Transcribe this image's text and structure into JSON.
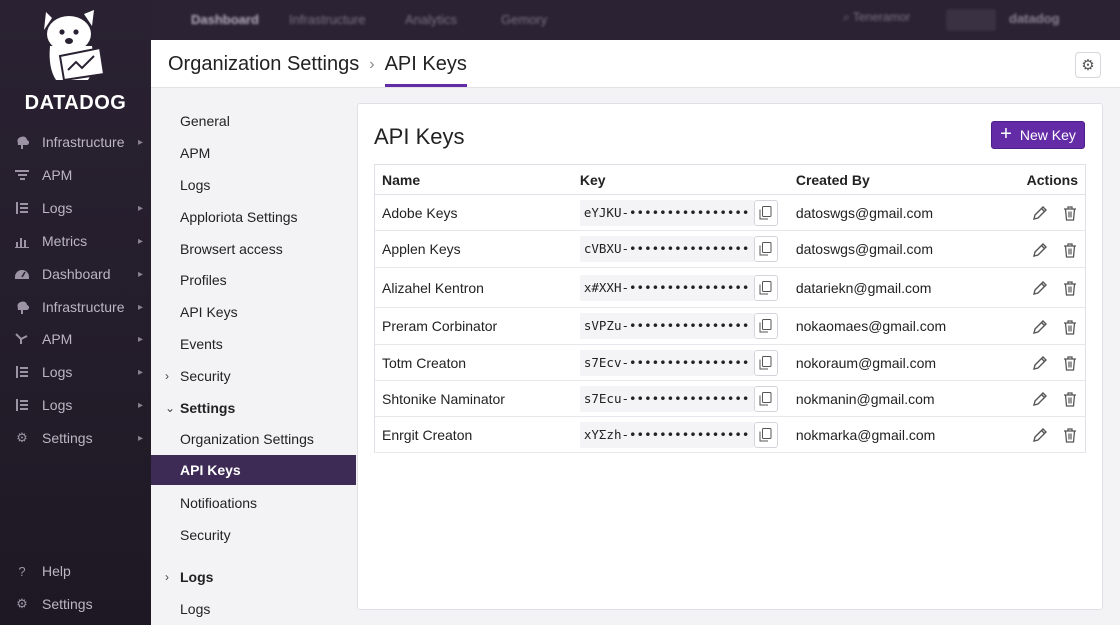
{
  "brand": {
    "name": "DATADOG"
  },
  "sidebar": {
    "items": [
      {
        "label": "Infrastructure",
        "icon": "infrastructure-icon",
        "chevron": true
      },
      {
        "label": "APM",
        "icon": "apm-icon",
        "chevron": false
      },
      {
        "label": "Logs",
        "icon": "logs-icon",
        "chevron": true
      },
      {
        "label": "Metrics",
        "icon": "metrics-icon",
        "chevron": true
      },
      {
        "label": "Dashboard",
        "icon": "dashboard-icon",
        "chevron": true
      },
      {
        "label": "Infrastructure",
        "icon": "infrastructure-icon",
        "chevron": true
      },
      {
        "label": "APM",
        "icon": "apm-icon",
        "chevron": true
      },
      {
        "label": "Logs",
        "icon": "logs-icon",
        "chevron": true
      },
      {
        "label": "Logs",
        "icon": "logs-icon",
        "chevron": true
      },
      {
        "label": "Settings",
        "icon": "gear-icon",
        "chevron": true
      }
    ],
    "bottom": [
      {
        "label": "Help",
        "icon": "help-icon"
      },
      {
        "label": "Settings",
        "icon": "gear-icon"
      }
    ]
  },
  "topbar": {
    "nav": [
      "Dashboard",
      "Infrastructure",
      "Analytics",
      "Gemory"
    ],
    "search": "Teneramor",
    "user": "datadog"
  },
  "header": {
    "parent": "Organization Settings",
    "current": "API Keys"
  },
  "submenu": {
    "items": [
      {
        "label": "General",
        "type": "item"
      },
      {
        "label": "APM",
        "type": "item"
      },
      {
        "label": "Logs",
        "type": "item"
      },
      {
        "label": "Apploriota Settings",
        "type": "item"
      },
      {
        "label": "Browsert access",
        "type": "item"
      },
      {
        "label": "Profiles",
        "type": "item"
      },
      {
        "label": "API Keys",
        "type": "item"
      },
      {
        "label": "Events",
        "type": "item"
      },
      {
        "label": "Security",
        "type": "group-collapsed"
      },
      {
        "label": "Settings",
        "type": "group-expanded"
      },
      {
        "label": "Organization Settings",
        "type": "item"
      },
      {
        "label": "API Keys",
        "type": "active"
      },
      {
        "label": "Notifioations",
        "type": "item"
      },
      {
        "label": "Security",
        "type": "item"
      },
      {
        "label": "Logs",
        "type": "group-collapsed"
      },
      {
        "label": "Logs",
        "type": "item"
      }
    ]
  },
  "main": {
    "title": "API Keys",
    "new_key_label": "New Key",
    "columns": [
      "Name",
      "Key",
      "Created By",
      "Actions"
    ],
    "rows": [
      {
        "name": "Adobe Keys",
        "key": "eYJKU-••••••••••••••••",
        "created_by": "datoswgs@gmail.com"
      },
      {
        "name": "Applen Keys",
        "key": "cVBXU-••••••••••••••••",
        "created_by": "datoswgs@gmail.com"
      },
      {
        "name": "Alizahel Kentron",
        "key": "x#XXH-••••••••••••••••",
        "created_by": "datariekn@gmail.com"
      },
      {
        "name": "Preram Corbinator",
        "key": "sVPZu-••••••••••••••••",
        "created_by": "nokaomaes@gmail.com"
      },
      {
        "name": "Totm Creaton",
        "key": "s7Ecv-••••••••••••••••",
        "created_by": "nokoraum@gmail.com"
      },
      {
        "name": "Shtonike Naminator",
        "key": "s7Ecu-••••••••••••••••",
        "created_by": "nokmanin@gmail.com"
      },
      {
        "name": "Enrgit Creaton",
        "key": "xYΣzh-••••••••••••••••",
        "created_by": "nokmarka@gmail.com"
      }
    ]
  },
  "colors": {
    "accent": "#632ca6",
    "sidebar_bg": "#2a2232",
    "active_submenu": "#3d2b55"
  }
}
